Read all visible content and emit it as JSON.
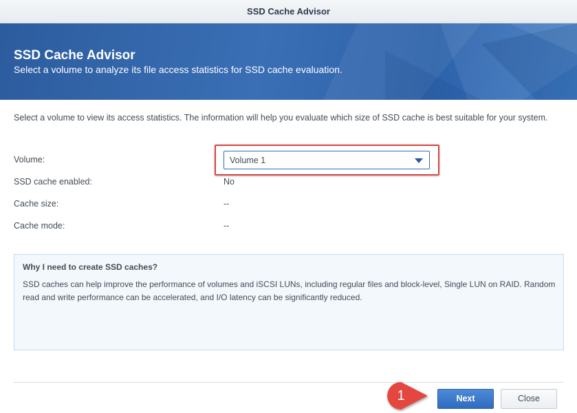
{
  "window": {
    "title": "SSD Cache Advisor"
  },
  "banner": {
    "title": "SSD Cache Advisor",
    "subtitle": "Select a volume to analyze its file access statistics for SSD cache evaluation."
  },
  "description": "Select a volume to view its access statistics. The information will help you evaluate which size of SSD cache is best suitable for your system.",
  "form": {
    "volume": {
      "label": "Volume:",
      "selected": "Volume 1"
    },
    "ssd_cache_enabled": {
      "label": "SSD cache enabled:",
      "value": "No"
    },
    "cache_size": {
      "label": "Cache size:",
      "value": "--"
    },
    "cache_mode": {
      "label": "Cache mode:",
      "value": "--"
    }
  },
  "info": {
    "title": "Why I need to create SSD caches?",
    "body": "SSD caches can help improve the performance of volumes and iSCSI LUNs, including regular files and block-level, Single LUN on RAID. Random read and write performance can be accelerated, and I/O latency can be significantly reduced."
  },
  "annotation": {
    "step_number": "1",
    "highlight_color": "#d64541"
  },
  "buttons": {
    "next": "Next",
    "close": "Close"
  },
  "colors": {
    "banner": "#3a6fb5",
    "primary_button": "#2f6bbf"
  }
}
